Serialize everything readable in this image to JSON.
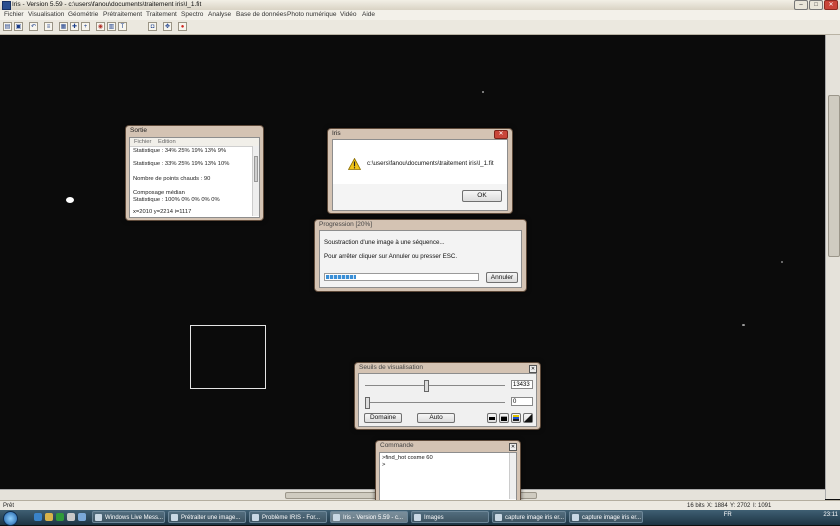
{
  "app": {
    "title": "Iris - Version 5.59 - c:\\users\\fanou\\documents\\traitement iris\\I_1.fit"
  },
  "window_buttons": [
    "–",
    "□",
    "✕"
  ],
  "menu": [
    "Fichier",
    "Visualisation",
    "Géométrie",
    "Prétraitement",
    "Traitement",
    "Spectro",
    "Analyse",
    "Base de données",
    "Photo numérique",
    "Vidéo",
    "Aide"
  ],
  "toolbar_icons": [
    "open-icon",
    "save-icon",
    "undo-icon",
    "list-icon",
    "grid-icon",
    "crosshair-icon",
    "zoom-in-icon",
    "palette-icon",
    "frame-icon",
    "text-icon",
    "camera-icon",
    "move-icon",
    "record-icon"
  ],
  "sortie": {
    "title": "Sortie",
    "menu": [
      "Fichier",
      "Edition"
    ],
    "lines": [
      "Statistique : 34% 25% 19% 13% 9%",
      "",
      "Statistique : 33% 25% 19% 13% 10%",
      "",
      "Nombre de points chauds : 90",
      "",
      "Composage médian",
      "Statistique : 100% 0% 0% 0% 0%",
      "",
      "x=2010  y=2214  i=1117"
    ]
  },
  "iris_dialog": {
    "title": "Iris",
    "message": "c:\\users\\fanou\\documents\\traitement iris\\I_1.fit",
    "ok": "OK"
  },
  "progression": {
    "title": "Progression [20%]",
    "line1": "Soustraction d'une image à une séquence...",
    "line2": "Pour arrêter cliquer sur Annuler ou presser ESC.",
    "progress": 0.2,
    "cancel": "Annuler"
  },
  "seuils": {
    "title": "Seuils de visualisation",
    "high_value": "13433",
    "low_value": "0",
    "high_level": 0.42,
    "low_level": 0.0,
    "domaine": "Domaine",
    "auto": "Auto"
  },
  "commande": {
    "title": "Commande",
    "lines": [
      ">find_hot cosme 60",
      ">"
    ]
  },
  "status": {
    "left": "Prêt",
    "bits": "16 bits",
    "x": "X: 1884",
    "y": "Y: 2702",
    "i": "I: 1091"
  },
  "taskbar": {
    "tasks": [
      "Windows Live Mess...",
      "Prétraiter une image...",
      "Problème IRIS - For...",
      "Iris - Version 5.59 - c...",
      "Images",
      "capture image iris er...",
      "capture image iris er..."
    ],
    "lang": "FR",
    "time": "23:11"
  },
  "colors": {
    "accent": "#3a8fd6",
    "window_frame": "#d4c3b3",
    "background": "#0b0b0b"
  }
}
